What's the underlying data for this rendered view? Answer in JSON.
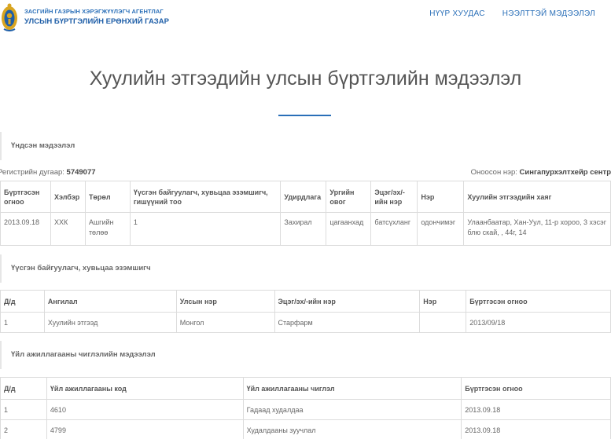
{
  "header": {
    "org_line1": "ЗАСГИЙН ГАЗРЫН ХЭРЭГЖҮҮЛЭГЧ АГЕНТЛАГ",
    "org_line2": "УЛСЫН БҮРТГЭЛИЙН ЕРӨНХИЙ ГАЗАР",
    "nav": [
      "НҮҮР ХУУДАС",
      "НЭЭЛТТЭЙ МЭДЭЭЛЭЛ"
    ]
  },
  "page_title": "Хуулийн этгээдийн улсын бүртгэлийн мэдээлэл",
  "section1": {
    "title": "Үндсэн мэдээлэл",
    "reg_label": "Регистрийн дугаар:",
    "reg_value": "5749077",
    "name_label": "Оноосон нэр:",
    "name_value": "Сингапурхэлтхейр сентр",
    "headers": [
      "Бүртгэсэн огноо",
      "Хэлбэр",
      "Төрөл",
      "Үүсгэн байгуулагч, хувьцаа эзэмшигч, гишүүний тоо",
      "Удирдлага",
      "Ургийн овог",
      "Эцэг/эх/-ийн нэр",
      "Нэр",
      "Хуулийн этгээдийн хаяг"
    ],
    "row": [
      "2013.09.18",
      "ХХК",
      "Ашгийн төлөө",
      "1",
      "Захирал",
      "цагаанхад",
      "батсүхланг",
      "одончимэг",
      "Улаанбаатар, Хан-Уул, 11-р хороо, 3 хэсэг блю скай, , 44г, 14"
    ]
  },
  "section2": {
    "title": "Үүсгэн байгуулагч, хувьцаа эзэмшигч",
    "headers": [
      "Д/д",
      "Ангилал",
      "Улсын нэр",
      "Эцэг/эх/-ийн нэр",
      "Нэр",
      "Бүртгэсэн огноо"
    ],
    "rows": [
      [
        "1",
        "Хуулийн этгээд",
        "Монгол",
        "Старфарм",
        "",
        "2013/09/18"
      ]
    ]
  },
  "section3": {
    "title": "Үйл ажиллагааны чиглэлийн мэдээлэл",
    "headers": [
      "Д/д",
      "Үйл ажиллагааны код",
      "Үйл ажиллагааны чиглэл",
      "Бүртгэсэн огноо"
    ],
    "rows": [
      [
        "1",
        "4610",
        "Гадаад худалдаа",
        "2013.09.18"
      ],
      [
        "2",
        "4799",
        "Худалдааны зуучлал",
        "2013.09.18"
      ]
    ]
  },
  "colors": {
    "brand_blue": "#2a6fb8",
    "emblem_gold": "#d9a520",
    "emblem_blue": "#1f5fa8"
  }
}
